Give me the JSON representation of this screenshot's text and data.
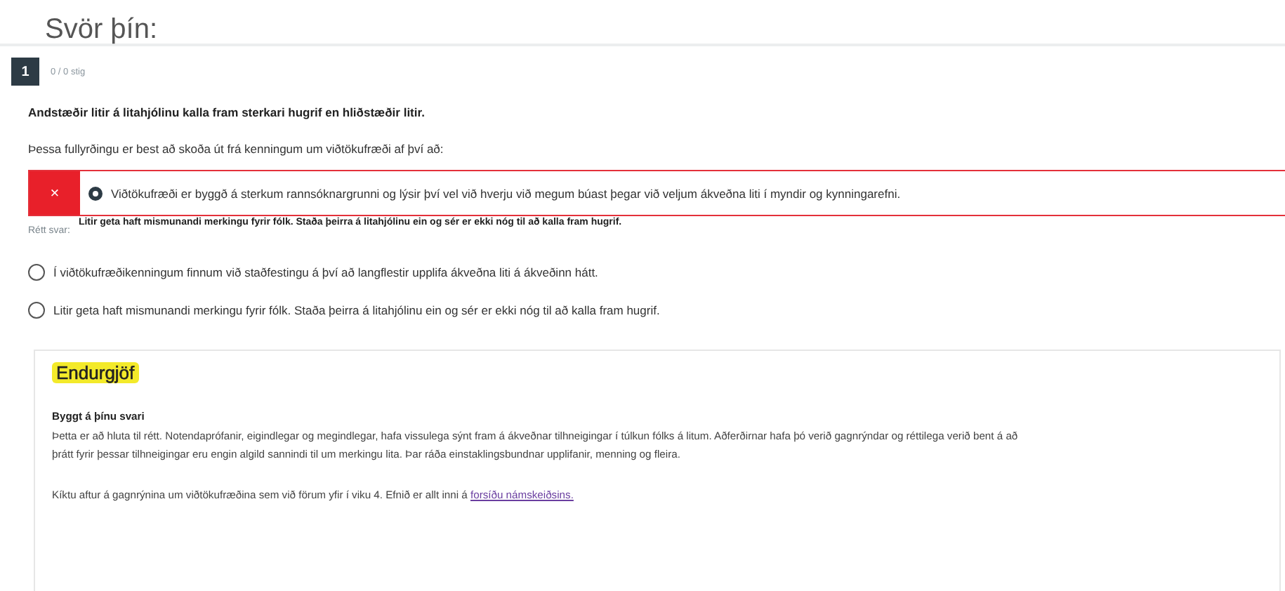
{
  "title": "Svör þín:",
  "question": {
    "number": "1",
    "points": "0 / 0 stig",
    "statement": "Andstæðir litir á litahjólinu kalla fram sterkari hugrif en hliðstæðir litir.",
    "prompt": "Þessa fullyrðingu er best að skoða út frá kenningum um viðtökufræði af því að:",
    "answers": [
      {
        "kind": "incorrect",
        "mark": "×",
        "selected": true,
        "text": "Viðtökufræði er byggð á sterkum rannsóknargrunni og lýsir því vel við hverju við megum búast þegar við veljum ákveðna liti í myndir og kynningarefni."
      }
    ],
    "correct_answer": {
      "label": "Rétt svar:",
      "text": "Litir geta haft mismunandi merkingu fyrir fólk. Staða þeirra á litahjólinu ein og sér er ekki nóg til að kalla fram hugrif."
    },
    "other_answers": [
      {
        "selected": false,
        "text": "Í viðtökufræðikenningum finnum við staðfestingu á því að langflestir upplifa ákveðna liti á ákveðinn hátt."
      },
      {
        "selected": false,
        "text": "Litir geta haft mismunandi merkingu fyrir fólk. Staða þeirra á litahjólinu ein og sér er ekki nóg til að kalla fram hugrif."
      }
    ]
  },
  "feedback": {
    "heading": "Endurgjöf",
    "subheading": "Byggt á þínu svari",
    "paragraph": "Þetta er að hluta til rétt. Notendaprófanir, eigindlegar og megindlegar, hafa vissulega sýnt fram á ákveðnar tilhneigingar í túlkun fólks á litum. Aðferðirnar hafa þó verið gagnrýndar og réttilega verið bent á að þrátt fyrir þessar tilhneigingar eru engin algild sannindi til um merkingu lita. Þar ráða einstaklingsbundnar upplifanir, menning og fleira.",
    "note": "Kíktu aftur á gagnrýnina um viðtökufræðina sem við förum yfir í viku 4. Efnið er allt inni á",
    "link": "forsíðu námskeiðsins."
  }
}
